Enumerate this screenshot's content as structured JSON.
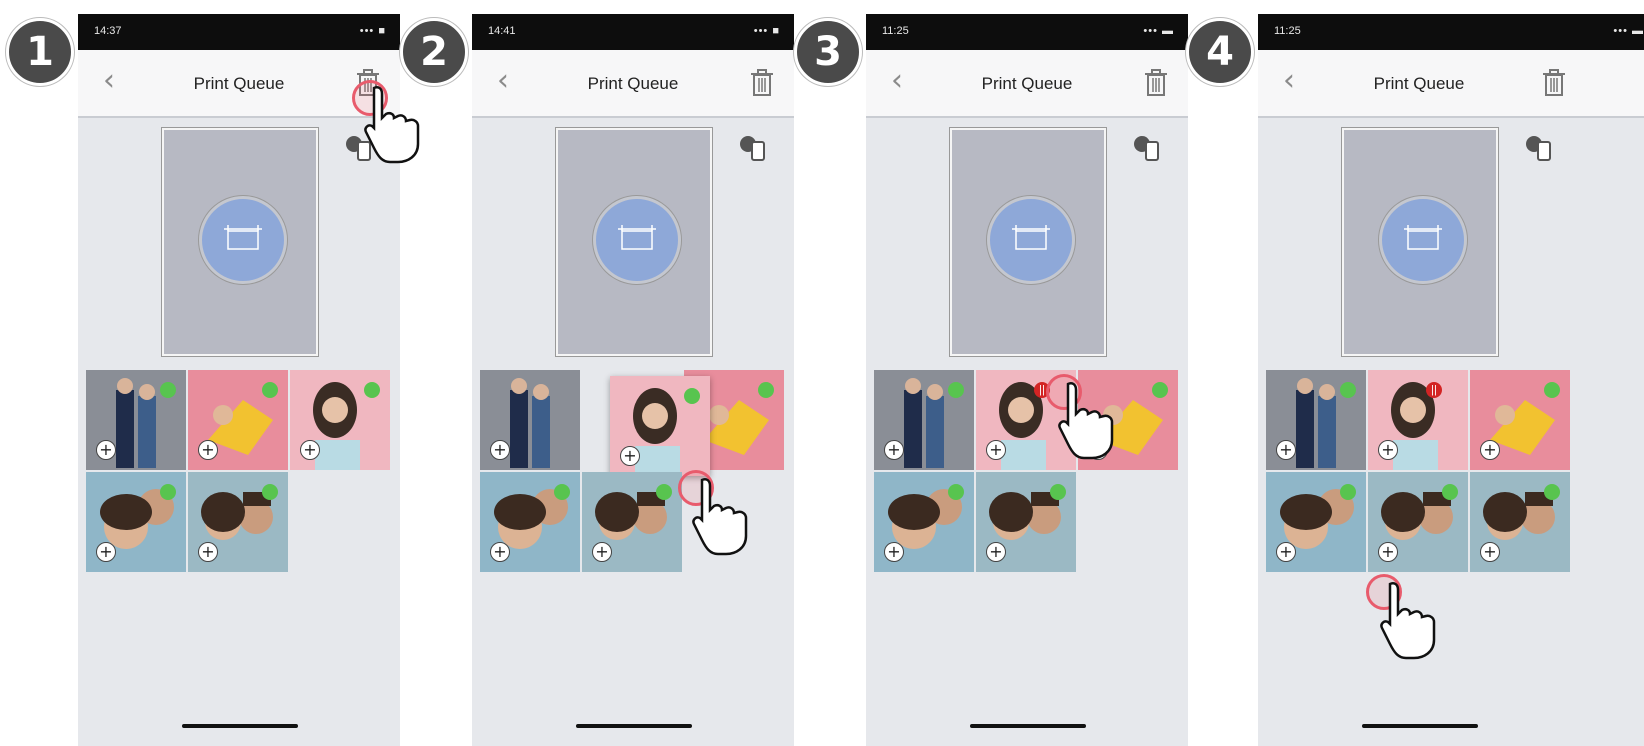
{
  "steps": [
    {
      "number": "1",
      "status_time": "14:37",
      "title": "Print Queue"
    },
    {
      "number": "2",
      "status_time": "14:41",
      "title": "Print Queue"
    },
    {
      "number": "3",
      "status_time": "11:25",
      "title": "Print Queue"
    },
    {
      "number": "4",
      "status_time": "11:25",
      "title": "Print Queue"
    }
  ],
  "icons": {
    "back": "chevron-left-icon",
    "trash": "trash-icon",
    "share": "share-device-icon",
    "printer": "printer-icon",
    "add": "plus-icon",
    "hand": "tap-hand-icon"
  },
  "colors": {
    "accent_blue": "#8ea8d8",
    "selected_green": "#58c44f",
    "remove_red": "#d32424",
    "tap_ring": "#e85b6c"
  }
}
